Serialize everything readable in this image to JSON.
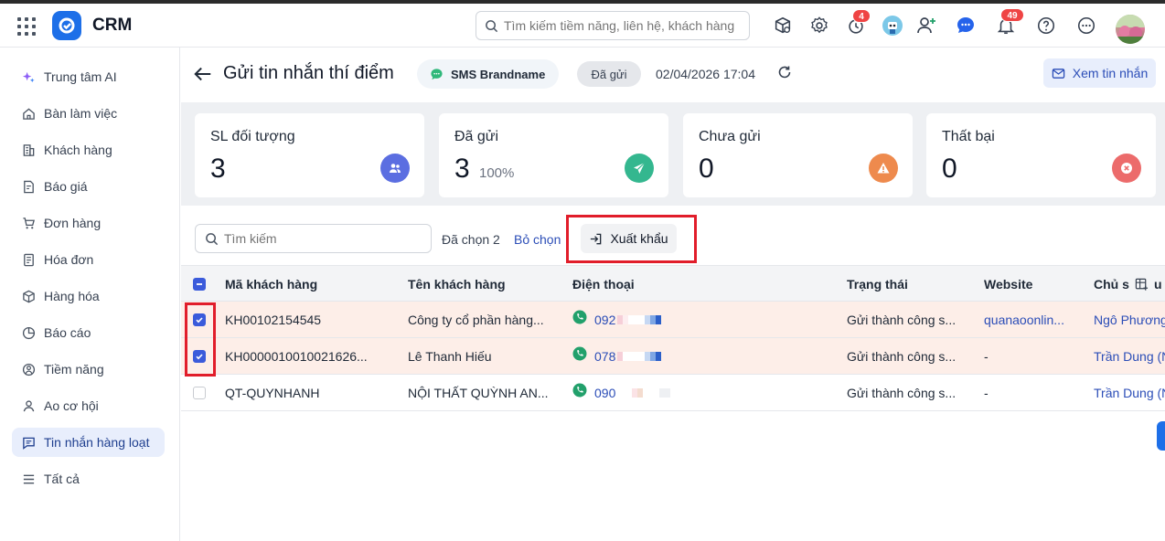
{
  "app": {
    "name": "CRM",
    "search_placeholder": "Tìm kiếm tiềm năng, liên hệ, khách hàng"
  },
  "topbar_icons": [
    {
      "name": "package-icon"
    },
    {
      "name": "gear-icon"
    },
    {
      "name": "timer-icon",
      "badge": "4"
    },
    {
      "name": "robot-avatar-icon"
    },
    {
      "name": "add-user-icon"
    },
    {
      "name": "chat-icon"
    },
    {
      "name": "bell-icon",
      "badge": "49"
    },
    {
      "name": "help-icon"
    },
    {
      "name": "more-icon"
    }
  ],
  "sidebar": {
    "items": [
      {
        "label": "Trung tâm AI",
        "icon": "sparkle-icon"
      },
      {
        "label": "Bàn làm việc",
        "icon": "home-icon"
      },
      {
        "label": "Khách hàng",
        "icon": "building-icon"
      },
      {
        "label": "Báo giá",
        "icon": "quote-icon"
      },
      {
        "label": "Đơn hàng",
        "icon": "cart-icon"
      },
      {
        "label": "Hóa đơn",
        "icon": "invoice-icon"
      },
      {
        "label": "Hàng hóa",
        "icon": "box-icon"
      },
      {
        "label": "Báo cáo",
        "icon": "pie-chart-icon"
      },
      {
        "label": "Tiềm năng",
        "icon": "target-icon"
      },
      {
        "label": "Ao cơ hội",
        "icon": "opportunity-icon"
      },
      {
        "label": "Tin nhắn hàng loạt",
        "icon": "message-icon",
        "active": true
      },
      {
        "label": "Tất cả",
        "icon": "menu-icon"
      }
    ]
  },
  "header": {
    "title": "Gửi tin nhắn thí điểm",
    "channel": "SMS Brandname",
    "status": "Đã gửi",
    "datetime": "02/04/2026 17:04",
    "view_button": "Xem tin nhắn"
  },
  "stats": [
    {
      "label": "SL đối tượng",
      "value": "3",
      "color": "#5b6ee1"
    },
    {
      "label": "Đã gửi",
      "value": "3",
      "percent": "100%",
      "color": "#34b78f"
    },
    {
      "label": "Chưa gửi",
      "value": "0",
      "color": "#ee8a4d"
    },
    {
      "label": "Thất bại",
      "value": "0",
      "color": "#ec6b6b"
    }
  ],
  "toolbar": {
    "search_placeholder": "Tìm kiếm",
    "selected_text": "Đã chọn 2",
    "deselect_label": "Bỏ chọn",
    "export_label": "Xuất khẩu"
  },
  "table": {
    "columns": [
      "Mã khách hàng",
      "Tên khách hàng",
      "Điện thoại",
      "Trạng thái",
      "Website",
      "Chủ s"
    ],
    "rows": [
      {
        "selected": true,
        "code": "KH00102154545",
        "name": "Công ty cổ phần hàng...",
        "phone": "092",
        "status": "Gửi thành công s...",
        "website": "quanaoonlin...",
        "owner": "Ngô Phương"
      },
      {
        "selected": true,
        "code": "KH0000010010021626...",
        "name": "Lê Thanh Hiếu",
        "phone": "078",
        "status": "Gửi thành công s...",
        "website": "-",
        "owner": "Trần Dung (N"
      },
      {
        "selected": false,
        "code": "QT-QUYNHANH",
        "name": "NỘI THẤT QUỲNH AN...",
        "phone": "090",
        "status": "Gửi thành công s...",
        "website": "-",
        "owner": "Trần Dung (N"
      }
    ]
  },
  "colors": {
    "accent": "#1d6fe8",
    "link": "#2b4db7",
    "selected_row": "#fdeee8",
    "highlight": "#e11d2a"
  }
}
